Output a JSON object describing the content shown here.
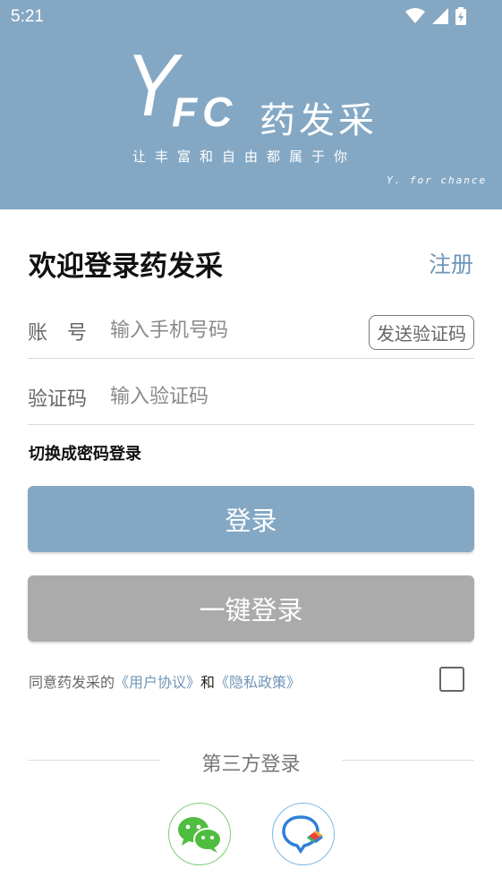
{
  "status_bar": {
    "time": "5:21"
  },
  "header": {
    "logo_y": "Y",
    "logo_fc": "FC",
    "logo_name": "药发采",
    "slogan": "让丰富和自由都属于你",
    "tagline": "Y. for chance",
    "background_color": "#84a8c4"
  },
  "login": {
    "title": "欢迎登录药发采",
    "register_label": "注册",
    "account_label": "账　号",
    "account_placeholder": "输入手机号码",
    "send_code_label": "发送验证码",
    "code_label": "验证码",
    "code_placeholder": "输入验证码",
    "switch_label": "切换成密码登录",
    "login_button": "登录",
    "onekey_button": "一键登录"
  },
  "agreement": {
    "prefix": "同意药发采的",
    "user_agreement": "《用户协议》",
    "and": "和",
    "privacy_policy": "《隐私政策》",
    "checked": false
  },
  "third_party": {
    "title": "第三方登录",
    "providers": [
      "wechat-icon",
      "chat-bubble-icon"
    ]
  },
  "colors": {
    "accent": "#84a8c4",
    "link": "#6f96b8",
    "disabled": "#ababab"
  }
}
